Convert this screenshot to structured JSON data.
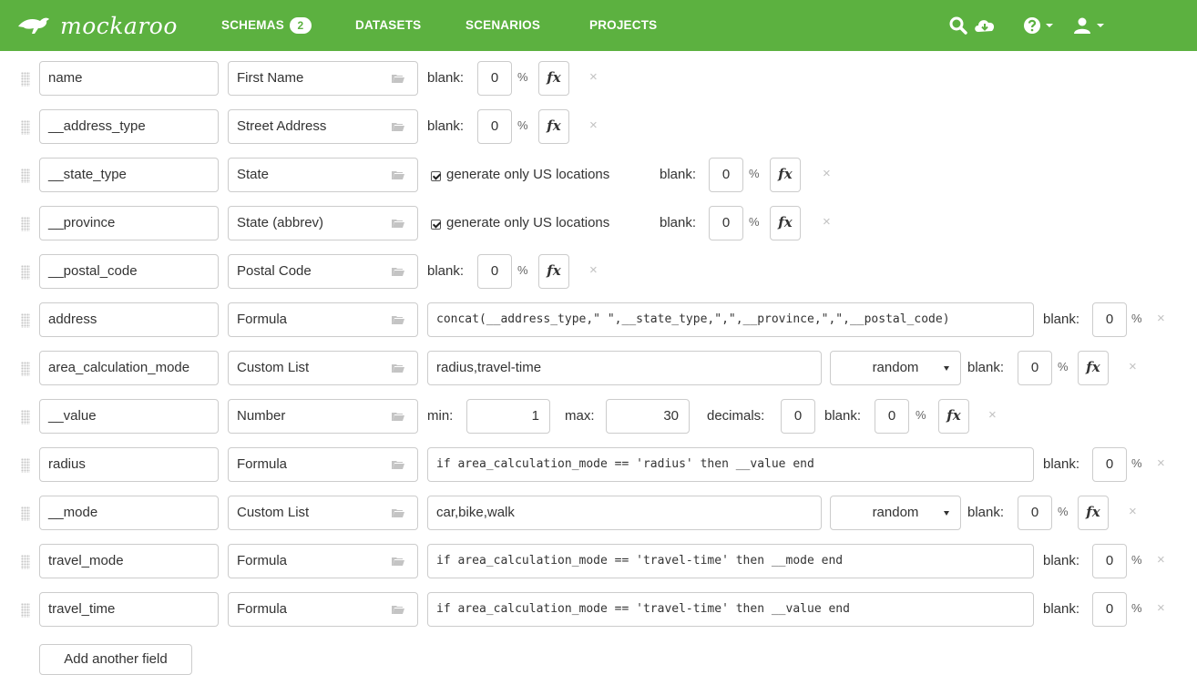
{
  "nav": {
    "brand": "mockaroo",
    "schemas_label": "SCHEMAS",
    "schemas_count": "2",
    "datasets_label": "DATASETS",
    "scenarios_label": "SCENARIOS",
    "projects_label": "PROJECTS"
  },
  "common": {
    "blank_label": "blank:",
    "percent": "%",
    "fx": "fx",
    "remove": "×",
    "us_label": "generate only US locations"
  },
  "fields": [
    {
      "name": "name",
      "type": "First Name",
      "blank": "0"
    },
    {
      "name": "__address_type",
      "type": "Street Address",
      "blank": "0"
    },
    {
      "name": "__state_type",
      "type": "State",
      "blank": "0",
      "us_only": true
    },
    {
      "name": "__province",
      "type": "State (abbrev)",
      "blank": "0",
      "us_only": true
    },
    {
      "name": "__postal_code",
      "type": "Postal Code",
      "blank": "0"
    },
    {
      "name": "address",
      "type": "Formula",
      "formula": "concat(__address_type,\" \",__state_type,\",\",__province,\",\",__postal_code)",
      "blank": "0"
    },
    {
      "name": "area_calculation_mode",
      "type": "Custom List",
      "values": "radius,travel-time",
      "selection": "random",
      "blank": "0"
    },
    {
      "name": "__value",
      "type": "Number",
      "min_label": "min:",
      "min": "1",
      "max_label": "max:",
      "max": "30",
      "decimals_label": "decimals:",
      "decimals": "0",
      "blank": "0"
    },
    {
      "name": "radius",
      "type": "Formula",
      "formula": "if area_calculation_mode == 'radius' then __value end",
      "blank": "0"
    },
    {
      "name": "__mode",
      "type": "Custom List",
      "values": "car,bike,walk",
      "selection": "random",
      "blank": "0"
    },
    {
      "name": "travel_mode",
      "type": "Formula",
      "formula": "if area_calculation_mode == 'travel-time' then __mode end",
      "blank": "0"
    },
    {
      "name": "travel_time",
      "type": "Formula",
      "formula": "if area_calculation_mode == 'travel-time' then __value end",
      "blank": "0"
    }
  ],
  "add_field_label": "Add another field",
  "colors": {
    "nav_green": "#5cb140",
    "border": "#cccccc"
  }
}
